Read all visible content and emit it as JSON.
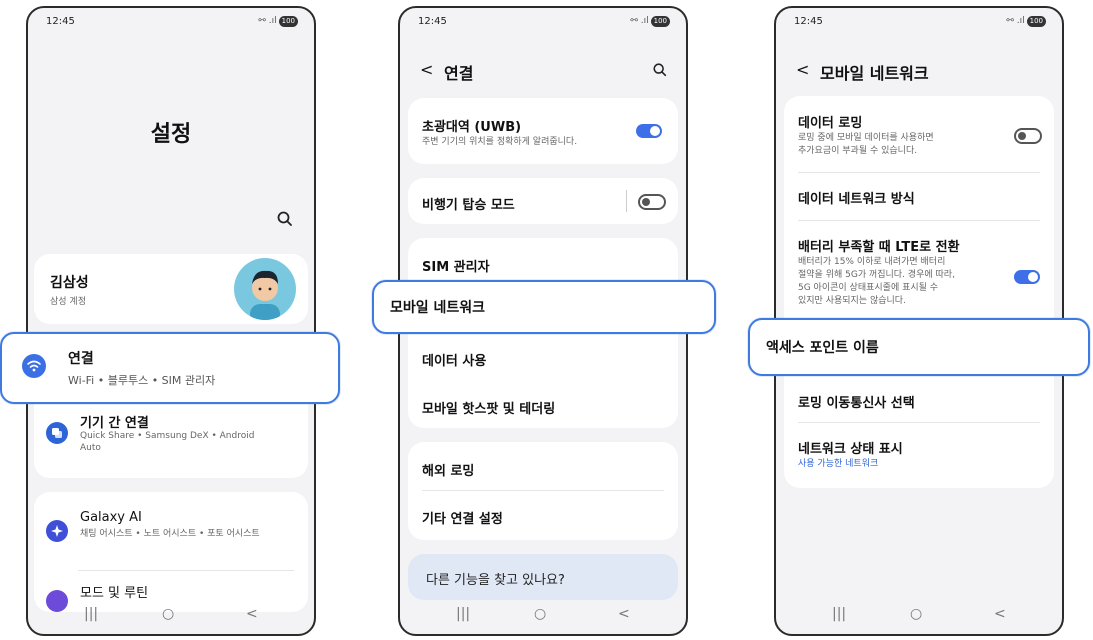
{
  "status": {
    "time": "12:45",
    "signal": "⚯ .ıl",
    "battery": "100"
  },
  "screen1": {
    "title": "설정",
    "profile": {
      "name": "김삼성",
      "account": "삼성 계정"
    },
    "items": [
      {
        "title": "연결",
        "sub": "Wi-Fi • 블루투스 • SIM 관리자",
        "icon_color": "#3b6fe4",
        "icon": "wifi-icon"
      },
      {
        "title": "기기 간 연결",
        "sub": "Quick Share • Samsung DeX • Android Auto",
        "icon_color": "#2f63d8",
        "icon": "device-link-icon"
      },
      {
        "title": "Galaxy AI",
        "sub": "채팅 어시스트 • 노트 어시스트 • 포토 어시스트",
        "icon_color": "#3f4fd8",
        "icon": "ai-icon"
      },
      {
        "title": "모드 및 루틴",
        "icon_color": "#6e4ad8",
        "icon": "routine-icon"
      }
    ]
  },
  "screen2": {
    "title": "연결",
    "uwb": {
      "title": "초광대역 (UWB)",
      "sub": "주변 기기의 위치를 정확하게 알려줍니다."
    },
    "airplane": "비행기 탑승 모드",
    "sim": "SIM 관리자",
    "mobile_network": "모바일 네트워크",
    "data_usage": "데이터 사용",
    "hotspot": "모바일 핫스팟 및 테더링",
    "roaming": "해외 로밍",
    "more": "기타 연결 설정",
    "looking": "다른 기능을 찾고 있나요?"
  },
  "screen3": {
    "title": "모바일 네트워크",
    "data_roaming": {
      "title": "데이터 로밍",
      "sub1": "로밍 중에 모바일 데이터를 사용하면",
      "sub2": "추가요금이 부과될 수 있습니다."
    },
    "network_mode": "데이터 네트워크 방식",
    "lte_low_batt": {
      "title": "배터리 부족할 때 LTE로 전환",
      "sub1": "배터리가 15% 이하로 내려가면 배터리",
      "sub2": "절약을 위해 5G가 꺼집니다. 경우에 따라,",
      "sub3": "5G 아이콘이 상태표시줄에 표시될 수",
      "sub4": "있지만 사용되지는 않습니다."
    },
    "apn": "액세스 포인트 이름",
    "operator": "로밍 이동통신사 선택",
    "status": {
      "title": "네트워크 상태 표시",
      "sub": "사용 가능한 네트워크"
    }
  },
  "colors": {
    "accent": "#3e6fe8",
    "highlight_border": "#3f7ae0",
    "link": "#2f63d8"
  }
}
